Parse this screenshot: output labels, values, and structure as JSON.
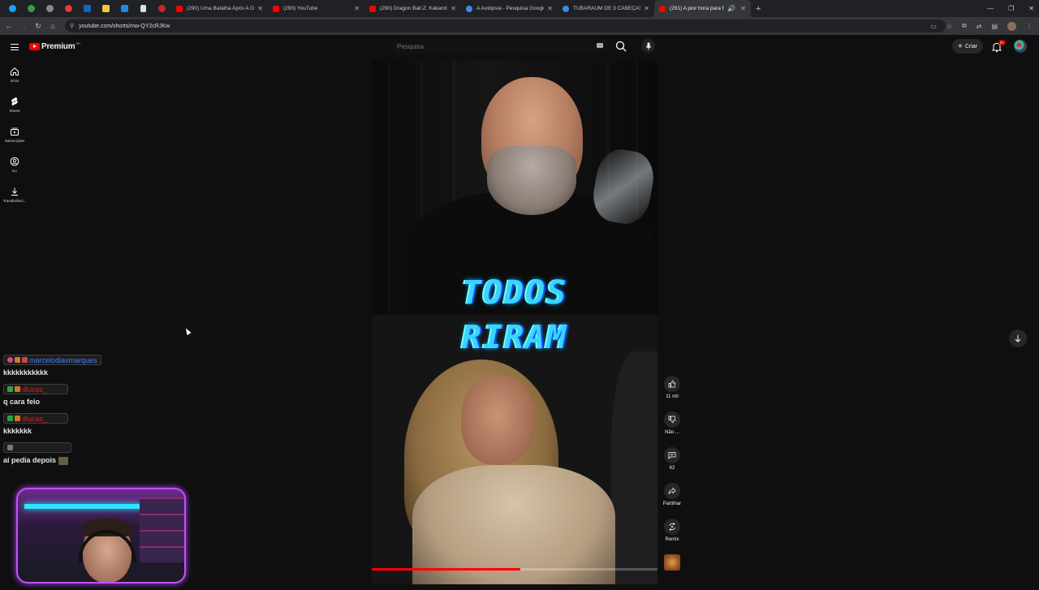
{
  "browser": {
    "tabs": [
      {
        "title": "(290) Uma Batalha Após A Outr",
        "favicon_color": "#ff0000"
      },
      {
        "title": "(290) YouTube",
        "favicon_color": "#ff0000"
      },
      {
        "title": "(290) Dragon Ball Z: Kakarot - E",
        "favicon_color": "#ff0000"
      },
      {
        "title": "A Autópsia - Pesquisa Google",
        "favicon_color": "#4285f4"
      },
      {
        "title": "TUBARAUM DE 3 CABEÇAS - Fr",
        "favicon_color": "#4285f4"
      },
      {
        "title": "(291) A pior hora para fazer",
        "favicon_color": "#ff0000",
        "active": true
      }
    ],
    "url": "youtube.com/shorts/mw-QY2cRJKw"
  },
  "header": {
    "brand": "Premium",
    "brand_sup": "BR",
    "search_placeholder": "Pesquisa",
    "create_label": "Criar",
    "notif_count": "9+"
  },
  "sidebar": {
    "items": [
      {
        "label": "Início",
        "icon": "home-icon"
      },
      {
        "label": "Shorts",
        "icon": "shorts-icon"
      },
      {
        "label": "Subscrições",
        "icon": "subscriptions-icon"
      },
      {
        "label": "Eu",
        "icon": "you-icon"
      },
      {
        "label": "Transferênci...",
        "icon": "download-icon"
      }
    ]
  },
  "video": {
    "caption_line1": "TODOS",
    "caption_line2": "RIRAM",
    "progress": 0.52
  },
  "actions": {
    "like_count": "11 mil",
    "dislike_label": "Não ...",
    "comments_count": "62",
    "share_label": "Partilhar",
    "remix_label": "Remix"
  },
  "chat": [
    {
      "user": "marcelodiasmarques",
      "user_color": "#3d7fff",
      "text": "kkkkkkkkkkk"
    },
    {
      "user": "dlucas_",
      "user_color": "#d42020",
      "text": "q cara feio"
    },
    {
      "user": "dlucas_",
      "user_color": "#d42020",
      "text": "kkkkkkk"
    },
    {
      "user": "",
      "user_color": "#ffffff",
      "text": "aí pedia depois"
    }
  ]
}
